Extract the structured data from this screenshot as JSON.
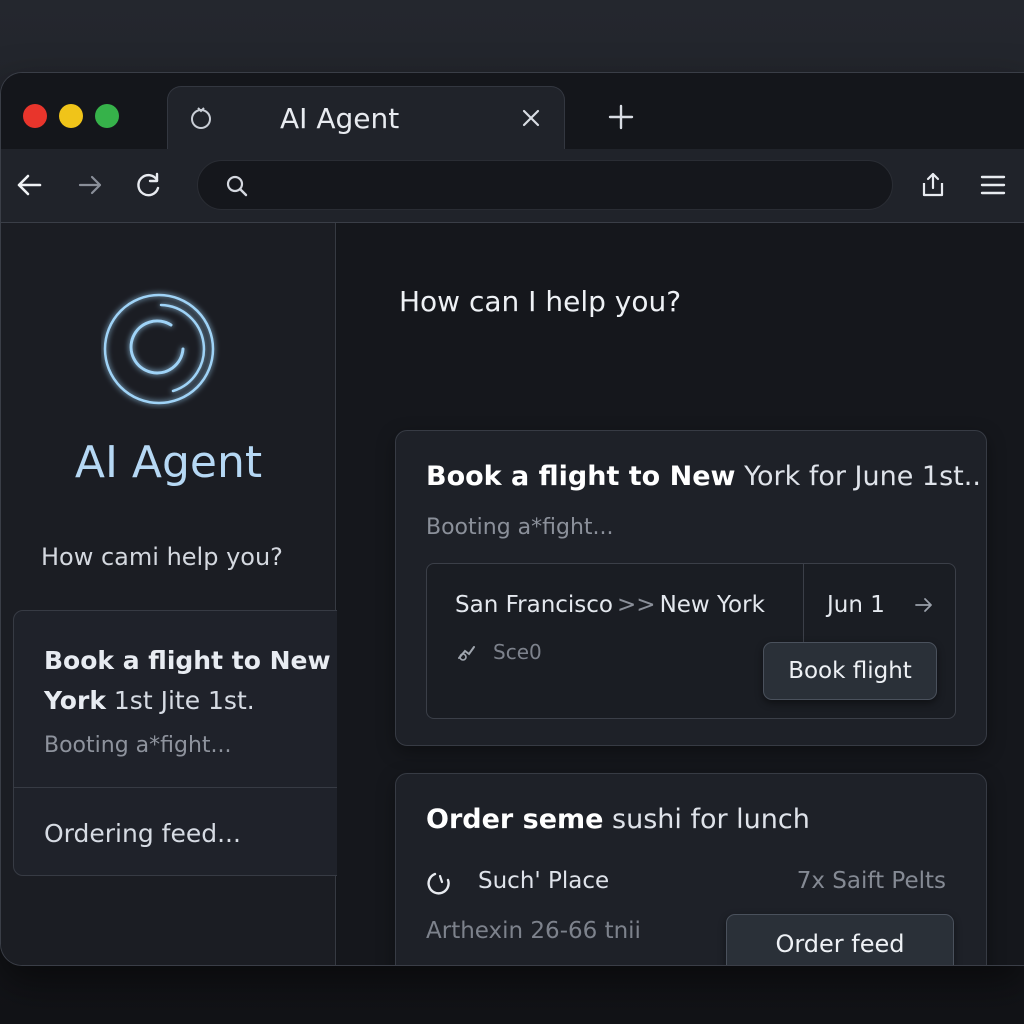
{
  "browser": {
    "tab_title": "AI Agent",
    "address_value": "",
    "colors": {
      "close": "#e8352c",
      "minimize": "#f0c419",
      "maximize": "#36b24a"
    }
  },
  "sidebar": {
    "title": "AI Agent",
    "prompt": "How cami help you?",
    "card": {
      "title_bold": "Book a flight to New York",
      "title_rest": " 1st Jite 1st.",
      "status": "Booting a*fight...",
      "order_status": "Ordering feed..."
    }
  },
  "main": {
    "prompt": "How can I help you?",
    "flight_card": {
      "title_bold": "Book a flight to New",
      "title_rest": " York for June 1st..",
      "status": "Booting a*fight...",
      "origin": "San Francisco",
      "separator": ">>",
      "destination": "New York",
      "date": "Jun 1",
      "meta": "Sce0",
      "book_label": "Book flight"
    },
    "sushi_card": {
      "title_bold": "Order seme",
      "title_rest": " sushi for lunch",
      "place": "Such' Place",
      "items": "7x Saift Pelts",
      "address": "Arthexin 26-66 tnii",
      "order_label": "Order feed"
    }
  },
  "accent_color": "#8cc8f2"
}
